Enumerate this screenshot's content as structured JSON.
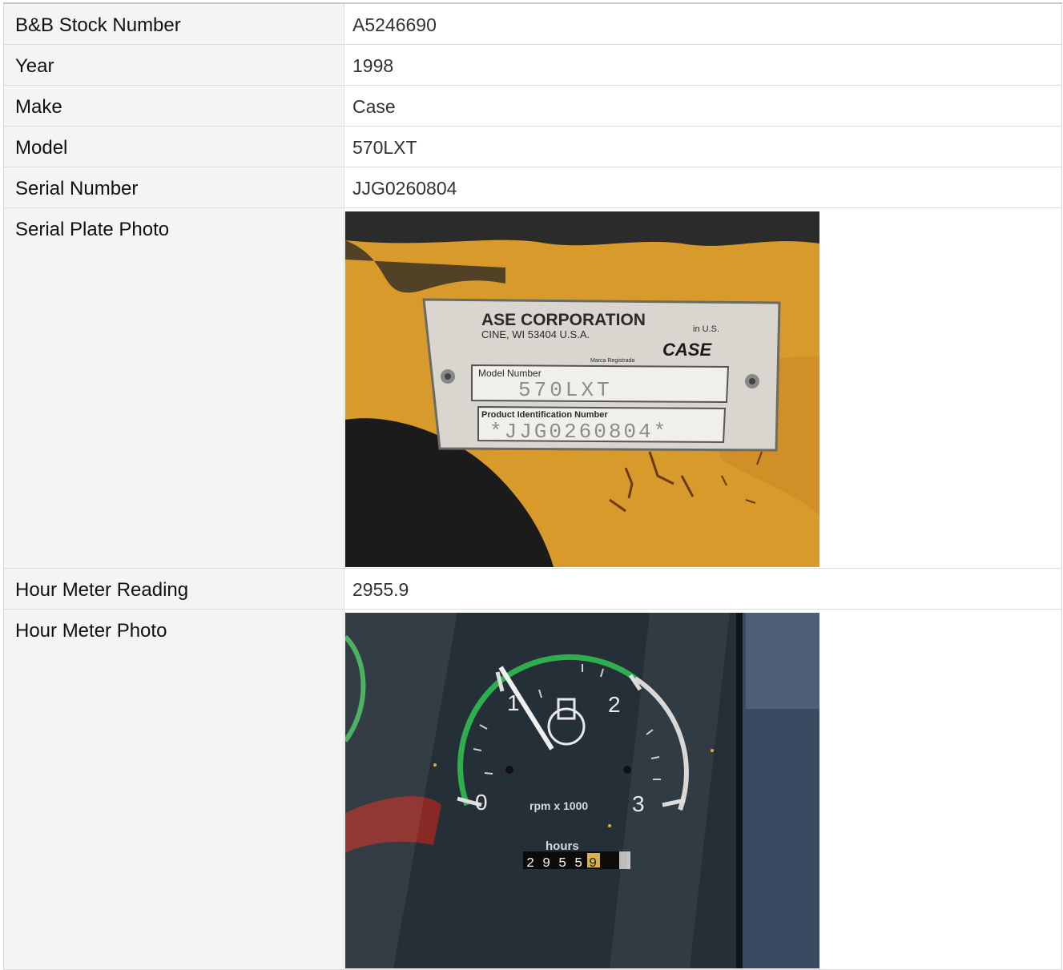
{
  "rows": [
    {
      "label": "B&B Stock Number",
      "value": "A5246690"
    },
    {
      "label": "Year",
      "value": "1998"
    },
    {
      "label": "Make",
      "value": "Case"
    },
    {
      "label": "Model",
      "value": "570LXT"
    },
    {
      "label": "Serial Number",
      "value": "JJG0260804"
    }
  ],
  "serial_photo": {
    "label": "Serial Plate Photo",
    "plate_line1": "ASE CORPORATION",
    "plate_line2": "CINE, WI 53404 U.S.A.",
    "plate_made": "in U.S.",
    "plate_brand": "CASE",
    "plate_registered": "Marca Registrada",
    "plate_model_caption": "Model Number",
    "plate_model": "570LXT",
    "plate_pin_caption": "Product Identification Number",
    "plate_pin": "*JJG0260804*"
  },
  "hour_meter": {
    "label": "Hour Meter Reading",
    "value": "2955.9"
  },
  "meter_photo": {
    "label": "Hour Meter Photo",
    "dial_numbers": [
      "0",
      "1",
      "2",
      "3"
    ],
    "rpm_caption": "rpm x 1000",
    "hours_caption": "hours",
    "odometer_digits": [
      "2",
      "9",
      "5",
      "5",
      "9"
    ]
  },
  "colors": {
    "plate_yellow": "#d99a2c",
    "gauge_green": "#2fae4e"
  }
}
